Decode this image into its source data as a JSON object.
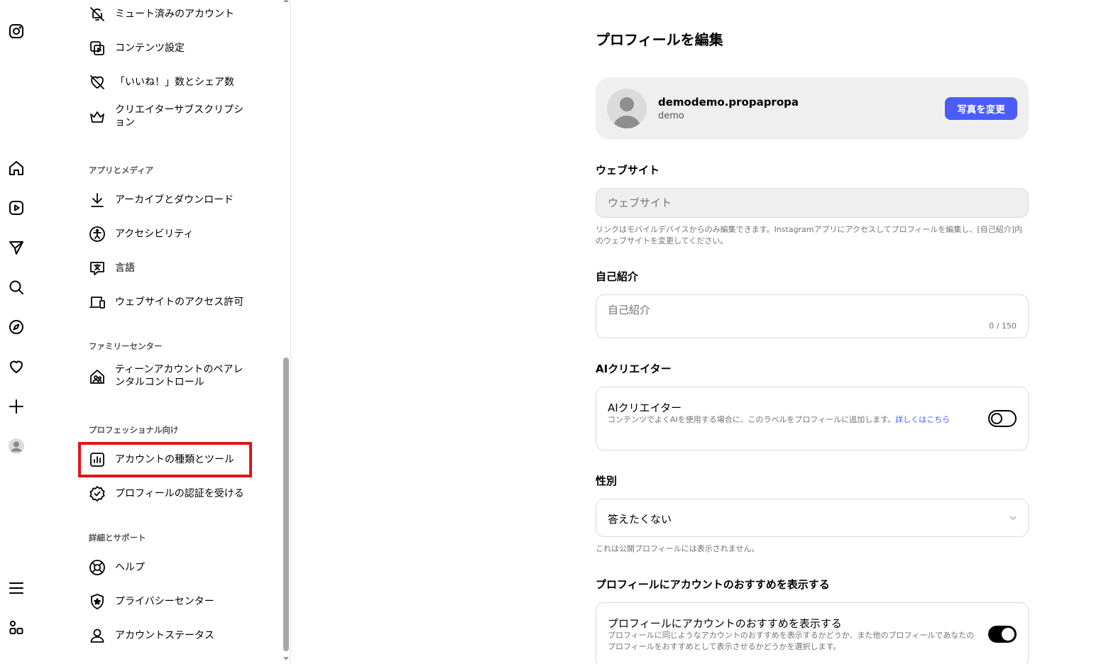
{
  "settings": {
    "items_top": [
      {
        "label": "ミュート済みのアカウント",
        "icon": "bell-off-icon"
      },
      {
        "label": "コンテンツ設定",
        "icon": "content-settings-icon"
      },
      {
        "label": "「いいね！」数とシェア数",
        "icon": "heart-off-icon"
      },
      {
        "label": "クリエイターサブスクリプション",
        "icon": "crown-icon"
      }
    ],
    "sections": {
      "apps_media": "アプリとメディア",
      "family": "ファミリーセンター",
      "professional": "プロフェッショナル向け",
      "support": "詳細とサポート"
    },
    "apps_items": [
      {
        "label": "アーカイブとダウンロード"
      },
      {
        "label": "アクセシビリティ"
      },
      {
        "label": "言語"
      },
      {
        "label": "ウェブサイトのアクセス許可"
      }
    ],
    "family_items": [
      {
        "label": "ティーンアカウントのペアレンタルコントロール"
      }
    ],
    "professional_items": [
      {
        "label": "アカウントの種類とツール"
      },
      {
        "label": "プロフィールの認証を受ける"
      }
    ],
    "support_items": [
      {
        "label": "ヘルプ"
      },
      {
        "label": "プライバシーセンター"
      },
      {
        "label": "アカウントステータス"
      }
    ]
  },
  "main": {
    "title": "プロフィールを編集",
    "profile": {
      "username": "demodemo.propapropa",
      "fullname": "demo",
      "change_photo": "写真を変更"
    },
    "website": {
      "heading": "ウェブサイト",
      "placeholder": "ウェブサイト",
      "hint": "リンクはモバイルデバイスからのみ編集できます。Instagramアプリにアクセスしてプロフィールを編集し、[自己紹介]内のウェブサイトを変更してください。"
    },
    "bio": {
      "heading": "自己紹介",
      "placeholder": "自己紹介",
      "counter": "0 / 150"
    },
    "ai": {
      "heading": "AIクリエイター",
      "title": "AIクリエイター",
      "desc": "コンテンツでよくAIを使用する場合に、このラベルをプロフィールに追加します。",
      "link": "詳しくはこちら",
      "enabled": false
    },
    "gender": {
      "heading": "性別",
      "value": "答えたくない",
      "hint": "これは公開プロフィールには表示されません。"
    },
    "suggestions": {
      "heading": "プロフィールにアカウントのおすすめを表示する",
      "title": "プロフィールにアカウントのおすすめを表示する",
      "desc": "プロフィールに同じようなアカウントのおすすめを表示するかどうか、また他のプロフィールであなたのプロフィールをおすすめとして表示させるかどうかを選択します。",
      "enabled": true
    }
  },
  "colors": {
    "accent": "#4a5df9",
    "highlight": "#e0151c"
  }
}
